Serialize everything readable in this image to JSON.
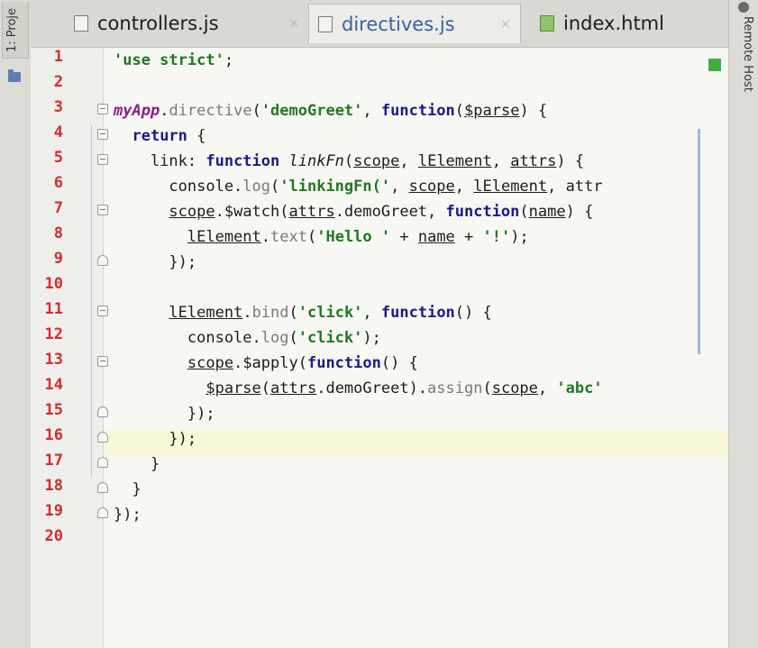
{
  "left_panel": {
    "label": "1: Proje"
  },
  "right_panel": {
    "label": "Remote Host"
  },
  "tabs": [
    {
      "name": "controllers.js",
      "active": false,
      "close": "×"
    },
    {
      "name": "directives.js",
      "active": true,
      "close": "×"
    },
    {
      "name": "index.html",
      "active": false
    }
  ],
  "line_numbers": [
    "1",
    "2",
    "3",
    "4",
    "5",
    "6",
    "7",
    "8",
    "9",
    "10",
    "11",
    "12",
    "13",
    "14",
    "15",
    "16",
    "17",
    "18",
    "19",
    "20"
  ],
  "code": [
    "'use strict';",
    "",
    "myApp.directive('demoGreet', function($parse) {",
    "  return {",
    "    link: function linkFn(scope, lElement, attrs) {",
    "      console.log('linkingFn(', scope, lElement, attr",
    "      scope.$watch(attrs.demoGreet, function(name) {",
    "        lElement.text('Hello ' + name + '!');",
    "      });",
    "",
    "      lElement.bind('click', function() {",
    "        console.log('click');",
    "        scope.$apply(function() {",
    "          $parse(attrs.demoGreet).assign(scope, 'abc'",
    "        });",
    "      });",
    "    }",
    "  }",
    "});",
    ""
  ],
  "highlighted_line": "16",
  "colors": {
    "line_number": "#d02d2d",
    "keyword": "#1c1a8a",
    "string": "#1f7a1f",
    "highlight": "#f9f9d8",
    "marker": "#3fae3f"
  }
}
